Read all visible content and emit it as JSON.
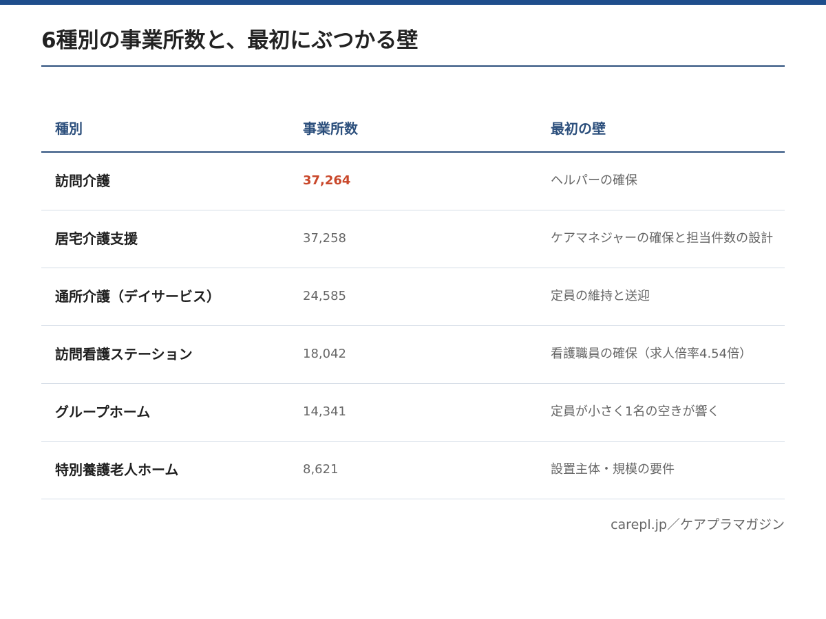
{
  "title": "6種別の事業所数と、最初にぶつかる壁",
  "colors": {
    "accent": "#1f4e8c",
    "header_text": "#2c4f7c",
    "highlight": "#c9472a",
    "muted_text": "#666666"
  },
  "table": {
    "headers": [
      "種別",
      "事業所数",
      "最初の壁"
    ],
    "rows": [
      {
        "type": "訪問介護",
        "count": "37,264",
        "wall": "ヘルパーの確保",
        "highlight": true
      },
      {
        "type": "居宅介護支援",
        "count": "37,258",
        "wall": "ケアマネジャーの確保と担当件数の設計",
        "highlight": false
      },
      {
        "type": "通所介護（デイサービス）",
        "count": "24,585",
        "wall": "定員の維持と送迎",
        "highlight": false
      },
      {
        "type": "訪問看護ステーション",
        "count": "18,042",
        "wall": "看護職員の確保（求人倍率4.54倍）",
        "highlight": false
      },
      {
        "type": "グループホーム",
        "count": "14,341",
        "wall": "定員が小さく1名の空きが響く",
        "highlight": false
      },
      {
        "type": "特別養護老人ホーム",
        "count": "8,621",
        "wall": "設置主体・規模の要件",
        "highlight": false
      }
    ]
  },
  "source": "carepl.jp／ケアプラマガジン"
}
